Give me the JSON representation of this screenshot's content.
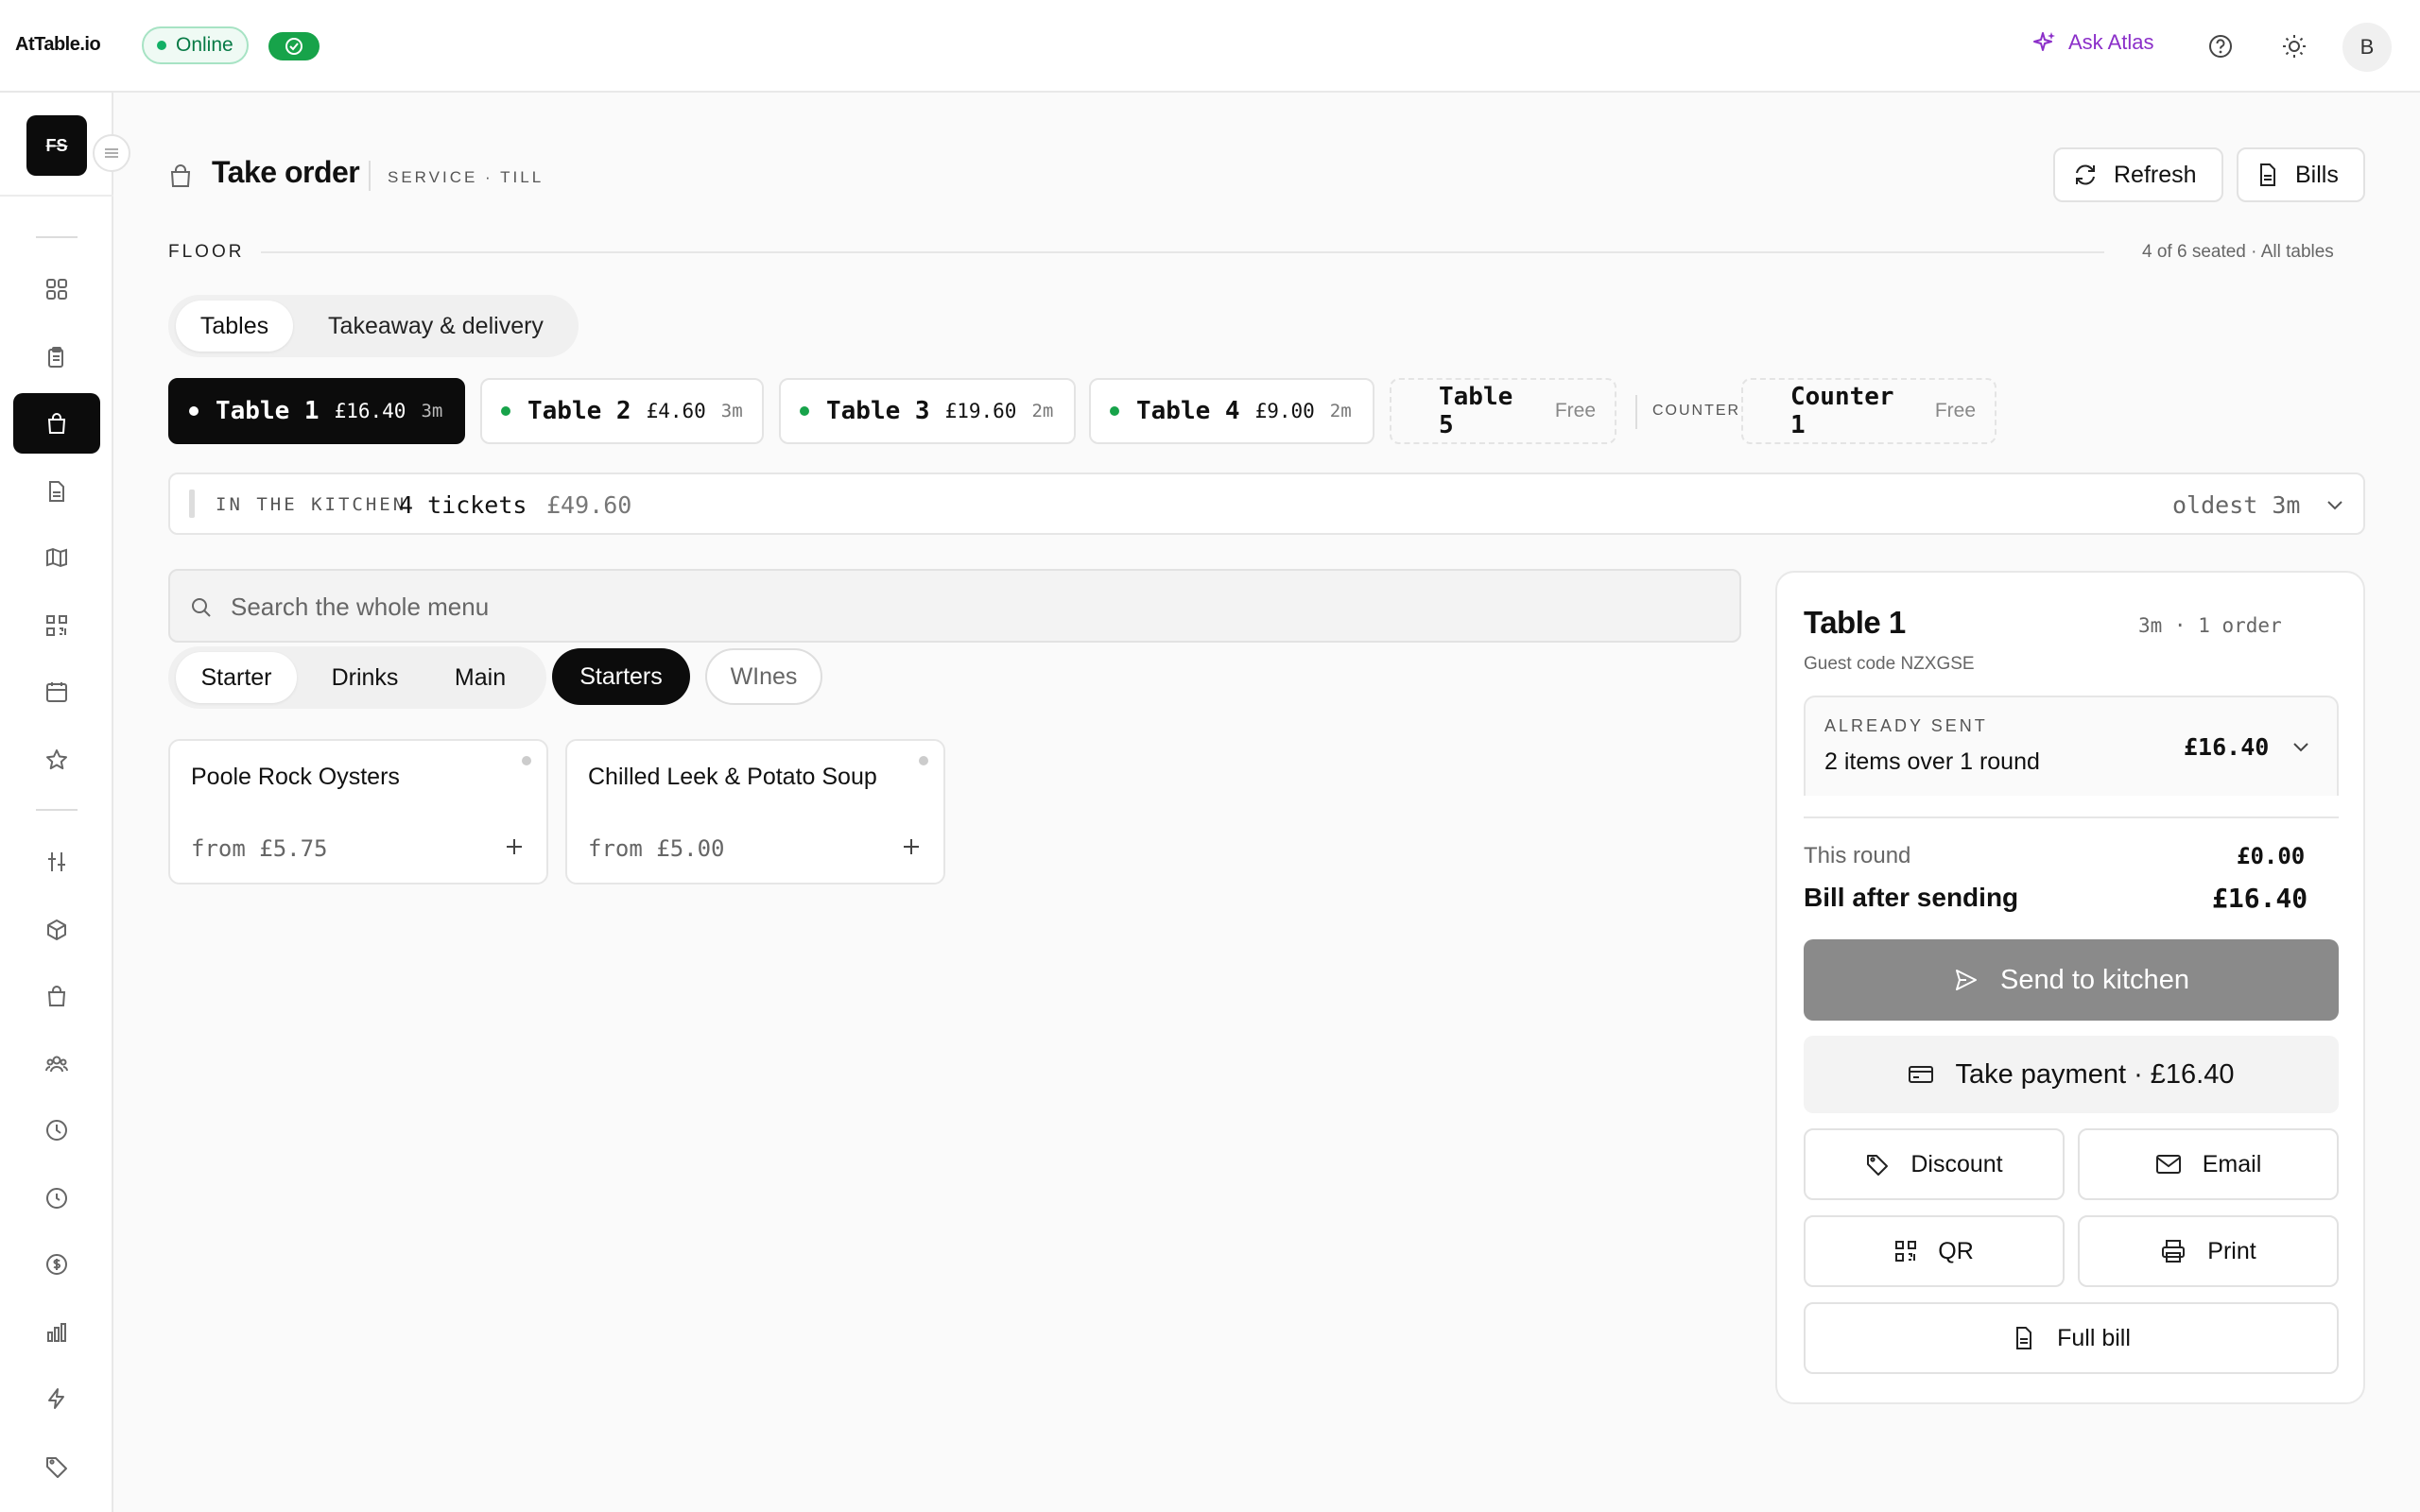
{
  "app": {
    "logo": "AtTable.io",
    "status": "Online",
    "ask_label": "Ask Atlas",
    "avatar_initial": "B",
    "accent_color": "#8b2fc9",
    "online_color": "#13b066"
  },
  "sidebar": {
    "brand_text": "FS",
    "active_index": 2,
    "icons": [
      "grid-icon",
      "clipboard-icon",
      "shopping-bag-icon",
      "document-icon",
      "map-icon",
      "qr-code-icon",
      "calendar-icon",
      "star-icon",
      "sliders-icon",
      "box-icon",
      "shopping-bag-icon",
      "users-icon",
      "clock-icon",
      "history-icon",
      "dollar-icon",
      "bar-chart-icon",
      "lightning-icon",
      "tag-icon"
    ]
  },
  "header": {
    "title": "Take order",
    "subtitle": "SERVICE · TILL",
    "refresh_label": "Refresh",
    "bills_label": "Bills"
  },
  "floor": {
    "label": "FLOOR",
    "summary": "4 of 6 seated · All tables",
    "modes": [
      "Tables",
      "Takeaway & delivery"
    ],
    "active_mode": "Tables",
    "tables": [
      {
        "name": "Table 1",
        "amount": "£16.40",
        "time": "3m",
        "active": true
      },
      {
        "name": "Table 2",
        "amount": "£4.60",
        "time": "3m"
      },
      {
        "name": "Table 3",
        "amount": "£19.60",
        "time": "2m"
      },
      {
        "name": "Table 4",
        "amount": "£9.00",
        "time": "2m"
      },
      {
        "name": "Table 5",
        "status": "Free"
      }
    ],
    "counter_label": "COUNTER",
    "counters": [
      {
        "name": "Counter 1",
        "status": "Free"
      }
    ]
  },
  "kitchen": {
    "label": "IN THE KITCHEN",
    "count": "4 tickets",
    "total": "£49.60",
    "oldest": "oldest 3m"
  },
  "menu": {
    "search_placeholder": "Search the whole menu",
    "categories": [
      "Starter",
      "Drinks",
      "Main",
      "Starters",
      "WInes"
    ],
    "active_category": "Starters",
    "items": [
      {
        "name": "Poole Rock Oysters",
        "price": "from £5.75"
      },
      {
        "name": "Chilled Leek & Potato Soup",
        "price": "from £5.00"
      }
    ]
  },
  "order": {
    "table": "Table 1",
    "meta": "3m · 1 order",
    "guest_code": "Guest code NZXGSE",
    "already_sent_label": "ALREADY SENT",
    "already_sent_desc": "2 items over 1 round",
    "already_sent_amount": "£16.40",
    "this_round_label": "This round",
    "this_round_amount": "£0.00",
    "bill_after_label": "Bill after sending",
    "bill_after_amount": "£16.40",
    "send_label": "Send to kitchen",
    "pay_label": "Take payment · £16.40",
    "discount_label": "Discount",
    "email_label": "Email",
    "qr_label": "QR",
    "print_label": "Print",
    "full_bill_label": "Full bill"
  }
}
